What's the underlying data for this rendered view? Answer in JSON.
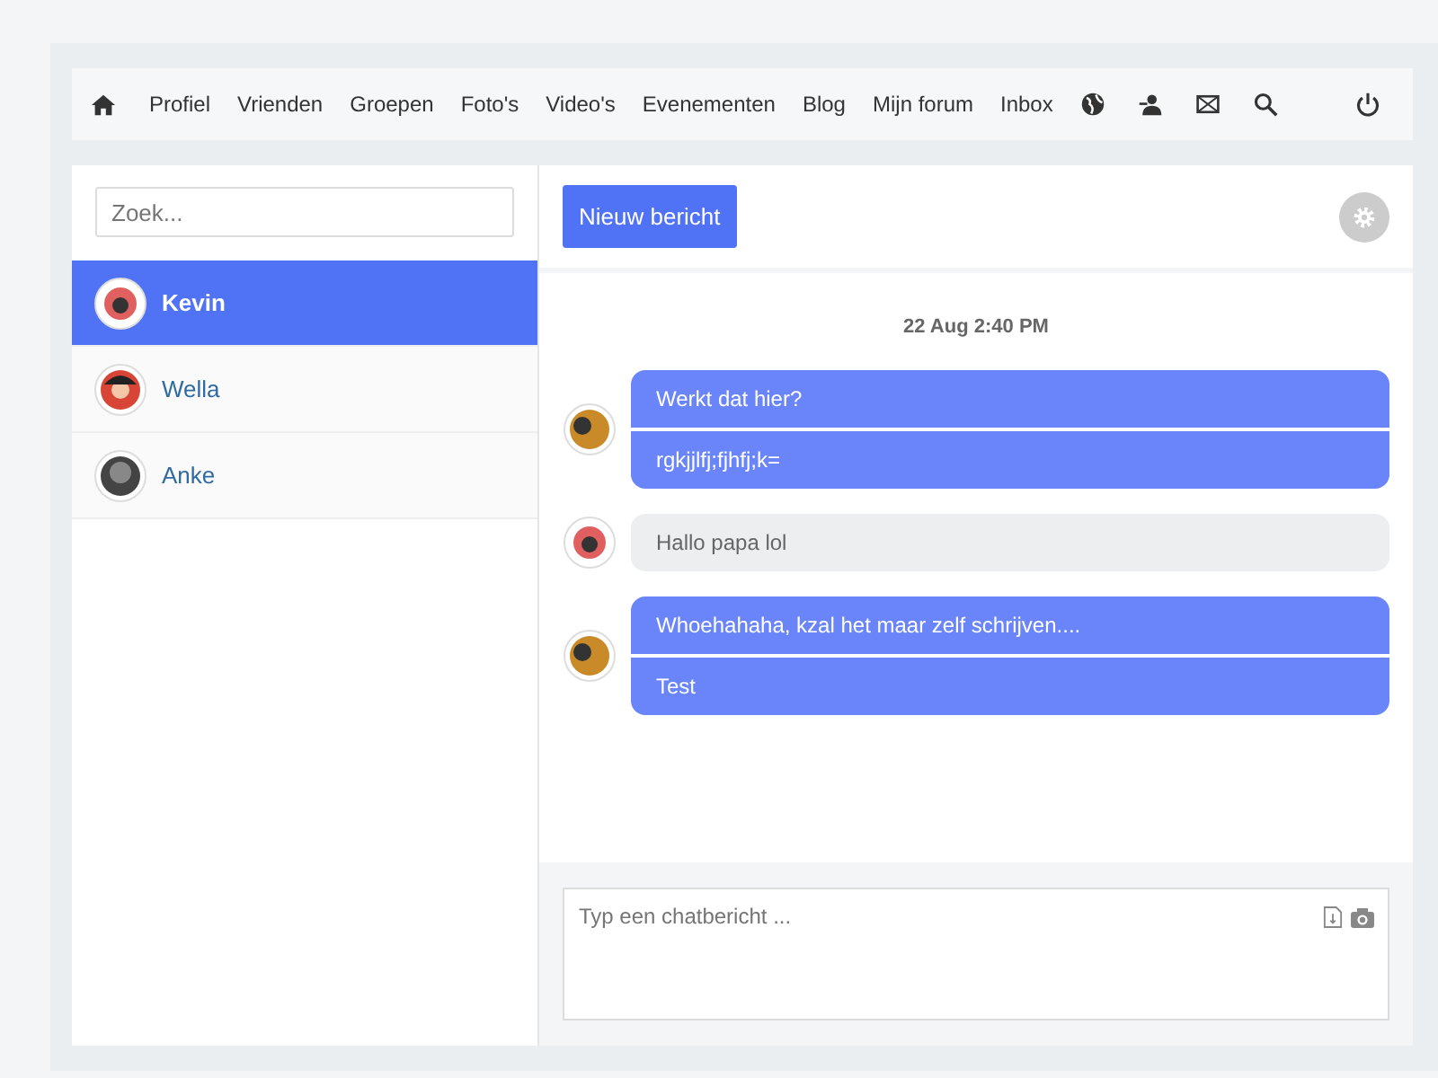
{
  "nav": {
    "links": [
      "Profiel",
      "Vrienden",
      "Groepen",
      "Foto's",
      "Video's",
      "Evenementen",
      "Blog",
      "Mijn forum",
      "Inbox"
    ]
  },
  "sidebar": {
    "search": {
      "placeholder": "Zoek..."
    },
    "contacts": [
      {
        "name": "Kevin",
        "selected": true,
        "avatar": {
          "kind": "camera"
        }
      },
      {
        "name": "Wella",
        "selected": false,
        "avatar": {
          "kind": "girl"
        }
      },
      {
        "name": "Anke",
        "selected": false,
        "avatar": {
          "kind": "dark"
        }
      }
    ]
  },
  "chat": {
    "new_button": "Nieuw bericht",
    "timestamp": "22 Aug 2:40 PM",
    "messages": [
      {
        "own": true,
        "avatar": {
          "kind": "photo"
        },
        "lines": [
          "Werkt dat hier?",
          "rgkjjlfj;fjhfj;k="
        ]
      },
      {
        "own": false,
        "avatar": {
          "kind": "camera"
        },
        "lines": [
          "Hallo papa lol"
        ]
      },
      {
        "own": true,
        "avatar": {
          "kind": "photo"
        },
        "lines": [
          "Whoehahaha, kzal het maar zelf schrijven....",
          "Test"
        ]
      }
    ],
    "composer": {
      "placeholder": "Typ een chatbericht ..."
    }
  }
}
